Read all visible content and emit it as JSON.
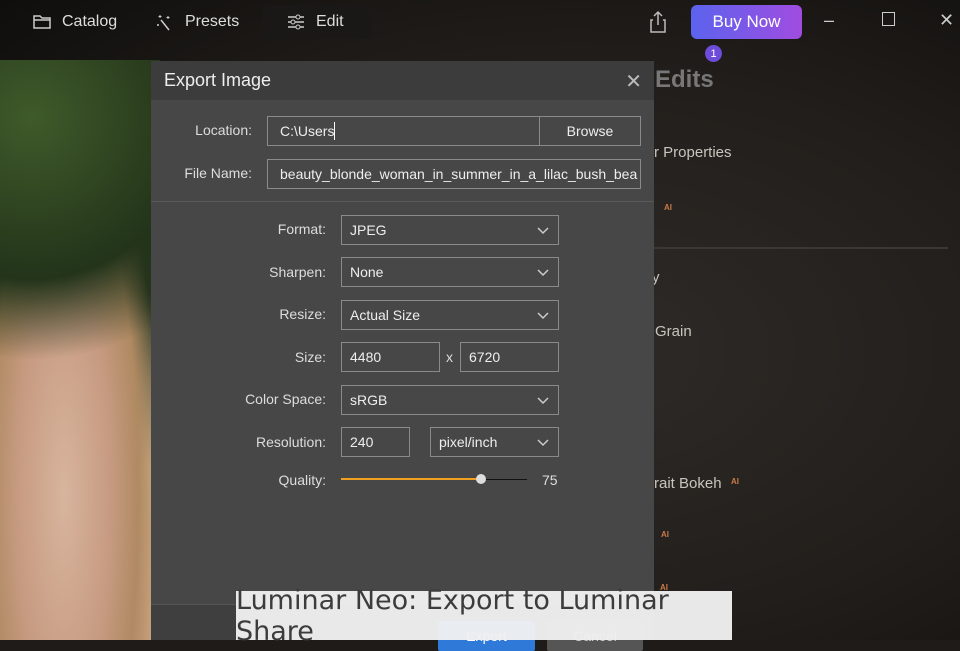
{
  "topbar": {
    "catalog": "Catalog",
    "presets": "Presets",
    "edit": "Edit",
    "buy_now": "Buy Now",
    "badge": "1"
  },
  "side_panel": {
    "heading": "Edits",
    "items": [
      "r Properties",
      "y",
      "Grain",
      "rait Bokeh"
    ],
    "ai": "AI"
  },
  "dialog": {
    "title": "Export Image",
    "location_label": "Location:",
    "location_value": "C:\\Users",
    "browse": "Browse",
    "filename_label": "File Name:",
    "filename_value": "beauty_blonde_woman_in_summer_in_a_lilac_bush_bea",
    "format_label": "Format:",
    "format_value": "JPEG",
    "sharpen_label": "Sharpen:",
    "sharpen_value": "None",
    "resize_label": "Resize:",
    "resize_value": "Actual Size",
    "size_label": "Size:",
    "width": "4480",
    "x": "x",
    "height": "6720",
    "colorspace_label": "Color Space:",
    "colorspace_value": "sRGB",
    "resolution_label": "Resolution:",
    "resolution_value": "240",
    "resolution_unit": "pixel/inch",
    "quality_label": "Quality:",
    "quality_value": "75",
    "quality_percent": 75,
    "export": "Export",
    "cancel": "Cancel"
  },
  "caption": "Luminar Neo: Export to Luminar Share",
  "colors": {
    "accent": "#f0a020",
    "buy_start": "#5b63ee",
    "buy_end": "#a04ce0"
  }
}
